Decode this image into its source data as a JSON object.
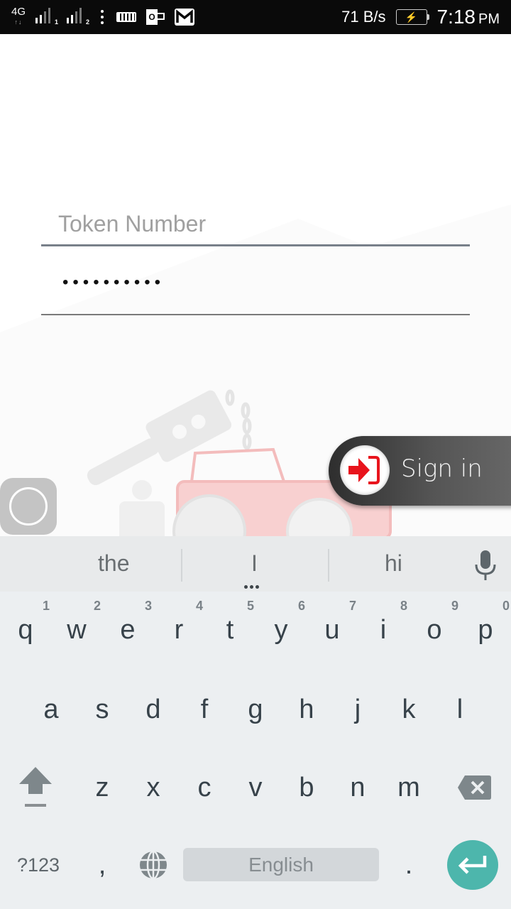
{
  "status_bar": {
    "network_type": "4G",
    "sim1_label": "1",
    "sim2_label": "2",
    "notification_icons": [
      "more-dots-icon",
      "keyboard-icon",
      "outlook-icon",
      "gmail-icon"
    ],
    "net_speed": "71 B/s",
    "battery_state": "charging",
    "time": "7:18",
    "ampm": "PM"
  },
  "login": {
    "token_placeholder": "Token Number",
    "token_value": "",
    "password_masked": "••••••••••",
    "password_length": 10,
    "signin_label": "Sign in"
  },
  "colors": {
    "signin_icon": "#e8141c",
    "enter_key": "#4db6ac",
    "keyboard_bg": "#eceff1",
    "tractor_tint": "#f6c6c6"
  },
  "keyboard": {
    "suggestions": [
      "the",
      "I",
      "hi"
    ],
    "row1": [
      {
        "key": "q",
        "hint": "1"
      },
      {
        "key": "w",
        "hint": "2"
      },
      {
        "key": "e",
        "hint": "3"
      },
      {
        "key": "r",
        "hint": "4"
      },
      {
        "key": "t",
        "hint": "5"
      },
      {
        "key": "y",
        "hint": "6"
      },
      {
        "key": "u",
        "hint": "7"
      },
      {
        "key": "i",
        "hint": "8"
      },
      {
        "key": "o",
        "hint": "9"
      },
      {
        "key": "p",
        "hint": "0"
      }
    ],
    "row2": [
      "a",
      "s",
      "d",
      "f",
      "g",
      "h",
      "j",
      "k",
      "l"
    ],
    "row3": [
      "z",
      "x",
      "c",
      "v",
      "b",
      "n",
      "m"
    ],
    "symbols_label": "?123",
    "comma": ",",
    "space_label": "English",
    "period": "."
  }
}
